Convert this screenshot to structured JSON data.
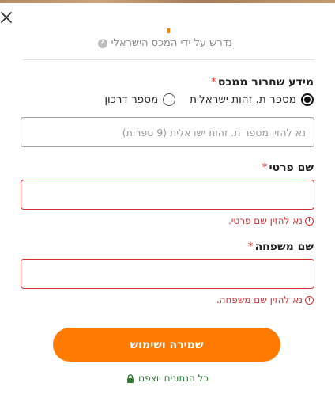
{
  "header": {
    "close_icon": "close-icon",
    "tax_authority_note": "נדרש על ידי המכס הישראלי",
    "help_icon_glyph": "?"
  },
  "form": {
    "customs_section": {
      "label": "מידע שחרור ממכס",
      "required_mark": "*",
      "radio_options": [
        {
          "label": "מספר ת. זהות ישראלית",
          "selected": true
        },
        {
          "label": "מספר דרכון",
          "selected": false
        }
      ],
      "id_input": {
        "value": "",
        "placeholder": "נא להזין מספר ת. זהות ישראלית (9 ספרות)"
      }
    },
    "first_name": {
      "label": "שם פרטי",
      "required_mark": "*",
      "value": "",
      "error": "נא להזין שם פרטי."
    },
    "last_name": {
      "label": "שם משפחה",
      "required_mark": "*",
      "value": "",
      "error": "נא להזין שם משפחה."
    },
    "error_icon_glyph": "!",
    "save_label": "שמירה ושימוש"
  },
  "footer": {
    "secure_note": "כל הנתונים יוצפנו",
    "lock_icon": "lock-icon"
  },
  "colors": {
    "accent": "#ff7a00",
    "error": "#d32f2f",
    "secure": "#2e7d32"
  }
}
